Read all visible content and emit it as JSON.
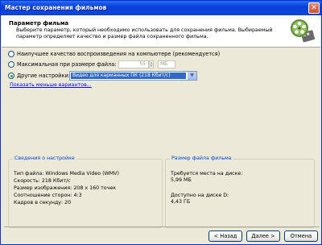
{
  "window": {
    "title": "Мастер сохранения фильмов",
    "close_glyph": "✕"
  },
  "header": {
    "title": "Параметр фильма",
    "description": "Выберите параметр, который необходимо использовать для сохранения фильма. Выбираемый параметр определяет качество и размер файла сохраненного фильма.",
    "icon": "film-reel-icon"
  },
  "options": {
    "best_quality": {
      "label": "Наилучшее качество воспроизведения на компьютере (рекомендуется)",
      "selected": false
    },
    "max_size": {
      "label": "Максимальная при размере файла:",
      "value": "55",
      "unit": "МБ",
      "selected": false
    },
    "other": {
      "label": "Другие настройки:",
      "selected_value": "Видео для карманных ПК (218 Кбит/с)",
      "selected": true
    }
  },
  "show_fewer_link": "Показать меньше вариантов...",
  "settings_info": {
    "title": "Сведения о настройке",
    "lines": [
      "Тип файла: Windows Media Video (WMV)",
      "Скорость: 218 Кбит/с",
      "Размер изображения: 208 x 160 точек",
      "Соотношение сторон: 4:3",
      "Кадров в секунду: 20"
    ]
  },
  "file_size": {
    "title": "Размер файла фильма",
    "required_label": "Требуется места на диске:",
    "required_value": "5,99 МБ",
    "available_label": "Доступно на диске D:",
    "available_value": "4,43 ГБ"
  },
  "buttons": {
    "back": "< Назад",
    "next": "Далее >",
    "cancel": "Отмена"
  },
  "colors": {
    "title_bar": "#0a46e0",
    "group_title": "#0046d5",
    "selection": "#316ac5",
    "link": "#0000ff"
  }
}
